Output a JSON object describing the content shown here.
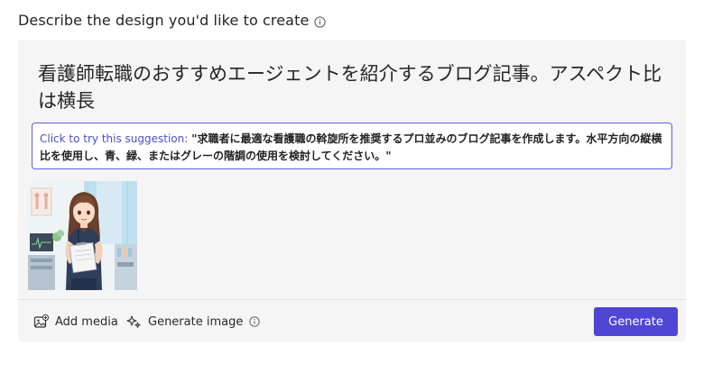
{
  "header": {
    "title": "Describe the design you'd like to create",
    "info_icon": "info-circle-icon"
  },
  "prompt": {
    "text": "看護師転職のおすすめエージェントを紹介するブログ記事。アスペクト比は横長"
  },
  "suggestion": {
    "prefix": "Click to try this suggestion:",
    "text": "\"求職者に最適な看護職の斡旋所を推奨するプロ並みのブログ記事を作成します。水平方向の縦横比を使用し、青、緑、またはグレーの階調の使用を検討してください。\""
  },
  "thumbnail": {
    "subject": "illustrated nurse holding clipboard in hospital room"
  },
  "toolbar": {
    "add_media_label": "Add media",
    "add_media_icon": "image-add-icon",
    "generate_image_label": "Generate image",
    "generate_image_icon": "sparkle-icon",
    "generate_image_info_icon": "info-circle-icon",
    "generate_label": "Generate"
  },
  "colors": {
    "accent": "#4f46d6",
    "suggestion_border": "#5b5fd6",
    "suggestion_prefix": "#4b4fcf",
    "panel_bg": "#f5f5f5"
  }
}
